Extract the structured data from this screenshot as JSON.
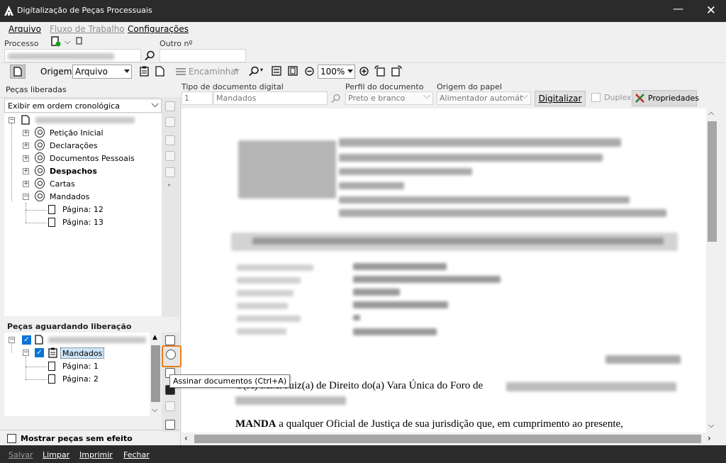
{
  "window": {
    "title": "Digitalização de Peças Processuais"
  },
  "menu": {
    "items": [
      "Arquivo",
      "Fluxo de Trabalho",
      "Configurações"
    ]
  },
  "process": {
    "processo_label": "Processo",
    "outro_label": "Outro nº"
  },
  "toolbar": {
    "origem_label": "Origem",
    "origem_value": "Arquivo",
    "encaminhar_label": "Encaminhar",
    "zoom_value": "100%"
  },
  "left_top": {
    "title": "Peças liberadas",
    "sort_value": "Exibir em ordem cronológica",
    "tree": [
      {
        "label": "Petição Inicial",
        "bold": false
      },
      {
        "label": "Declarações",
        "bold": false
      },
      {
        "label": "Documentos Pessoais",
        "bold": false
      },
      {
        "label": "Despachos",
        "bold": true
      },
      {
        "label": "Cartas",
        "bold": false
      },
      {
        "label": "Mandados",
        "bold": false
      }
    ],
    "pages": [
      "Página: 12",
      "Página: 13"
    ]
  },
  "left_bottom": {
    "title": "Peças aguardando liberação",
    "item": "Mandados",
    "pages": [
      "Página: 1",
      "Página: 2"
    ],
    "mostrar_label": "Mostrar peças sem efeito"
  },
  "digital": {
    "tipo_label": "Tipo de documento digital",
    "tipo_code": "1",
    "tipo_value": "Mandados",
    "perfil_label": "Perfil do documento",
    "perfil_value": "Preto e branco",
    "origem_papel_label": "Origem do papel",
    "origem_papel_value": "Alimentador automát",
    "digitalizar_label": "Digitalizar",
    "duplex_label": "Duplex",
    "propriedades_label": "Propriedades"
  },
  "document": {
    "line1_start": "O(A) MM. Juiz(a) de Direito do(a) Vara Única do Foro de",
    "line2_bold": "MANDA",
    "line2_rest": " a qualquer Oficial de Justiça de sua jurisdição que, em cumprimento ao presente,"
  },
  "tooltip": {
    "text": "Assinar documentos (Ctrl+A)"
  },
  "status": {
    "items": [
      "Salvar",
      "Limpar",
      "Imprimir",
      "Fechar"
    ]
  },
  "colors": {
    "title_bg": "#2b2b2b",
    "highlight": "#e87d1e",
    "check_blue": "#0b74d6",
    "selection": "#cce4f7"
  }
}
